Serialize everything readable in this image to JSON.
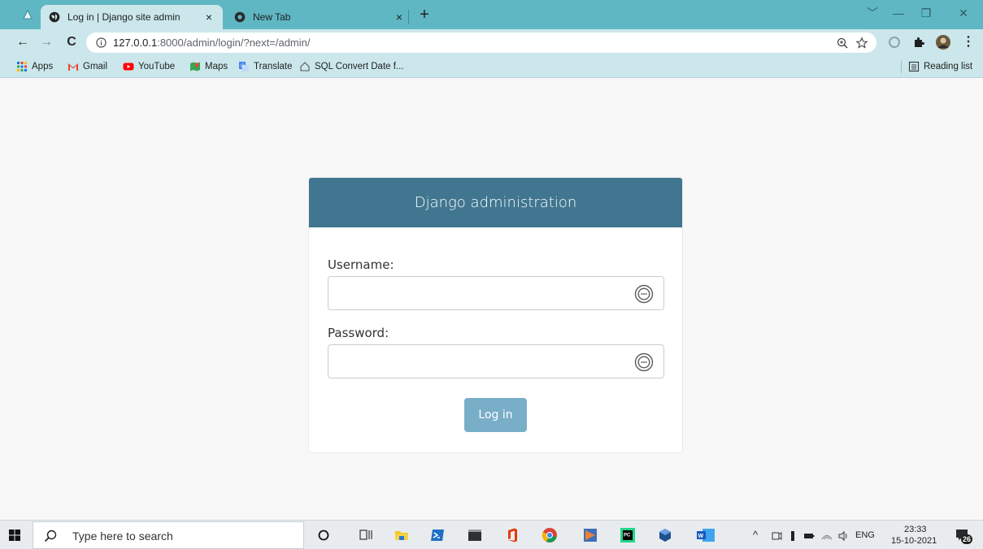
{
  "browser": {
    "tabs": [
      {
        "title": "Log in | Django site admin",
        "close": "×"
      },
      {
        "title": "New Tab",
        "close": "×"
      }
    ],
    "new_tab": "+",
    "window_controls": {
      "dropdown": "﹀",
      "minimize": "—",
      "restore": "❐",
      "close": "✕"
    },
    "address_bar": {
      "host": "127.0.0.1",
      "path": ":8000/admin/login/?next=/admin/"
    },
    "nav": {
      "back": "←",
      "forward": "→",
      "reload": "C"
    },
    "menu": "⋮",
    "bookmarks": [
      {
        "label": "Apps",
        "icon": "apps-grid-icon"
      },
      {
        "label": "Gmail",
        "icon": "gmail-icon"
      },
      {
        "label": "YouTube",
        "icon": "youtube-icon"
      },
      {
        "label": "Maps",
        "icon": "maps-icon"
      },
      {
        "label": "Translate",
        "icon": "translate-icon"
      },
      {
        "label": "SQL Convert Date f...",
        "icon": "page-icon"
      }
    ],
    "reading_list": "Reading list"
  },
  "page": {
    "header_title": "Django administration",
    "username_label": "Username:",
    "password_label": "Password:",
    "login_button": "Log in"
  },
  "taskbar": {
    "search_placeholder": "Type here to search",
    "language": "ENG",
    "time": "23:33",
    "date": "15-10-2021",
    "notification_count": "26",
    "tray_chevron": "^"
  },
  "colors": {
    "django_header": "#417690",
    "login_button": "#79aec8",
    "tab_strip": "#5fb7c3",
    "toolbar": "#cbe7eb"
  }
}
